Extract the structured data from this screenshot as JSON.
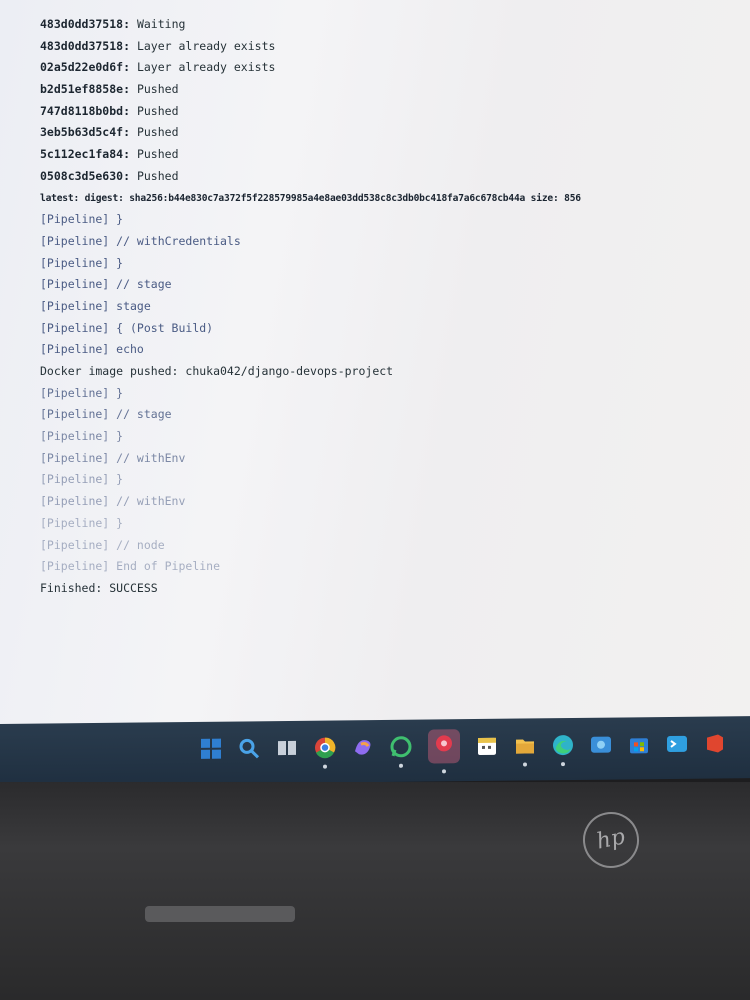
{
  "console": {
    "lines": [
      {
        "id": "layer1",
        "hash": "483d0dd37518:",
        "status": "Waiting"
      },
      {
        "id": "layer2",
        "hash": "483d0dd37518:",
        "status": "Layer already exists"
      },
      {
        "id": "layer3",
        "hash": "02a5d22e0d6f:",
        "status": "Layer already exists"
      },
      {
        "id": "layer4",
        "hash": "b2d51ef8858e:",
        "status": "Pushed"
      },
      {
        "id": "layer5",
        "hash": "747d8118b0bd:",
        "status": "Pushed"
      },
      {
        "id": "layer6",
        "hash": "3eb5b63d5c4f:",
        "status": "Pushed"
      },
      {
        "id": "layer7",
        "hash": "5c112ec1fa84:",
        "status": "Pushed"
      },
      {
        "id": "layer8",
        "hash": "0508c3d5e630:",
        "status": "Pushed"
      }
    ],
    "digest": "latest: digest: sha256:b44e830c7a372f5f228579985a4e8ae03dd538c8c3db0bc418fa7a6c678cb44a size: 856",
    "pipeline": [
      "[Pipeline] }",
      "[Pipeline] // withCredentials",
      "[Pipeline] }",
      "[Pipeline] // stage",
      "[Pipeline] stage",
      "[Pipeline] { (Post Build)",
      "[Pipeline] echo"
    ],
    "docker_pushed": "Docker image pushed: chuka042/django-devops-project",
    "pipeline_tail": [
      "[Pipeline] }",
      "[Pipeline] // stage",
      "[Pipeline] }",
      "[Pipeline] // withEnv",
      "[Pipeline] }",
      "[Pipeline] // withEnv",
      "[Pipeline] }",
      "[Pipeline] // node",
      "[Pipeline] End of Pipeline"
    ],
    "finished": "Finished: SUCCESS"
  },
  "taskbar": {
    "icons": [
      {
        "name": "start-icon",
        "color": "#2f7fd1"
      },
      {
        "name": "search-icon",
        "color": "#4aa3e8"
      },
      {
        "name": "task-view-icon",
        "color": "#c8d0da"
      },
      {
        "name": "chrome-icon",
        "color": "#f0b429"
      },
      {
        "name": "copilot-icon",
        "color": "#8e6cf0"
      },
      {
        "name": "whatsapp-icon",
        "color": "#3fbf6f"
      },
      {
        "name": "record-app-icon",
        "color": "#e23b4e"
      },
      {
        "name": "calendar-app-icon",
        "color": "#e8c24a"
      },
      {
        "name": "file-explorer-icon",
        "color": "#f2c14e"
      },
      {
        "name": "edge-icon",
        "color": "#2fb3c9"
      },
      {
        "name": "photos-icon",
        "color": "#3a8fd9"
      },
      {
        "name": "store-icon",
        "color": "#2e7fd6"
      },
      {
        "name": "terminal-app-icon",
        "color": "#2f9fe0"
      },
      {
        "name": "office-icon",
        "color": "#e0462f"
      }
    ]
  }
}
